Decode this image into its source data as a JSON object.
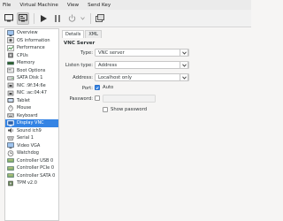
{
  "menu": [
    "File",
    "Virtual Machine",
    "View",
    "Send Key"
  ],
  "toolbar": {
    "buttons": [
      "console-icon",
      "details-icon",
      "run-icon",
      "pause-icon",
      "power-icon",
      "power-menu-icon",
      "snapshot-icon"
    ]
  },
  "sidebar": {
    "items": [
      {
        "label": "Overview",
        "icon": "overview-icon"
      },
      {
        "label": "OS information",
        "icon": "os-icon"
      },
      {
        "label": "Performance",
        "icon": "performance-icon"
      },
      {
        "label": "CPUs",
        "icon": "cpu-icon"
      },
      {
        "label": "Memory",
        "icon": "memory-icon"
      },
      {
        "label": "Boot Options",
        "icon": "boot-icon"
      },
      {
        "label": "SATA Disk 1",
        "icon": "disk-icon"
      },
      {
        "label": "NIC :9f:34:6e",
        "icon": "nic-icon"
      },
      {
        "label": "NIC :ac:04:47",
        "icon": "nic-icon"
      },
      {
        "label": "Tablet",
        "icon": "tablet-icon"
      },
      {
        "label": "Mouse",
        "icon": "mouse-icon"
      },
      {
        "label": "Keyboard",
        "icon": "keyboard-icon"
      },
      {
        "label": "Display VNC",
        "icon": "display-icon",
        "selected": true
      },
      {
        "label": "Sound ich9",
        "icon": "sound-icon"
      },
      {
        "label": "Serial 1",
        "icon": "serial-icon"
      },
      {
        "label": "Video VGA",
        "icon": "video-icon"
      },
      {
        "label": "Watchdog",
        "icon": "watchdog-icon"
      },
      {
        "label": "Controller USB 0",
        "icon": "controller-icon"
      },
      {
        "label": "Controller PCIe 0",
        "icon": "controller-icon"
      },
      {
        "label": "Controller SATA 0",
        "icon": "controller-icon"
      },
      {
        "label": "TPM v2.0",
        "icon": "tpm-icon"
      }
    ]
  },
  "tabs": [
    {
      "label": "Details",
      "active": true
    },
    {
      "label": "XML",
      "active": false
    }
  ],
  "vnc": {
    "title": "VNC Server",
    "type_label": "Type:",
    "type_value": "VNC server",
    "listen_label": "Listen type:",
    "listen_value": "Address",
    "address_label": "Address:",
    "address_value": "Localhost only",
    "port_label": "Port:",
    "port_auto_label": "Auto",
    "port_auto_checked": true,
    "password_label": "Password:",
    "password_value": "",
    "password_checked": false,
    "show_password_label": "Show password",
    "show_password_checked": false
  },
  "colors": {
    "selection": "#3584e4",
    "menubar_bg": "#ebebeb",
    "window_bg": "#f6f5f4"
  }
}
